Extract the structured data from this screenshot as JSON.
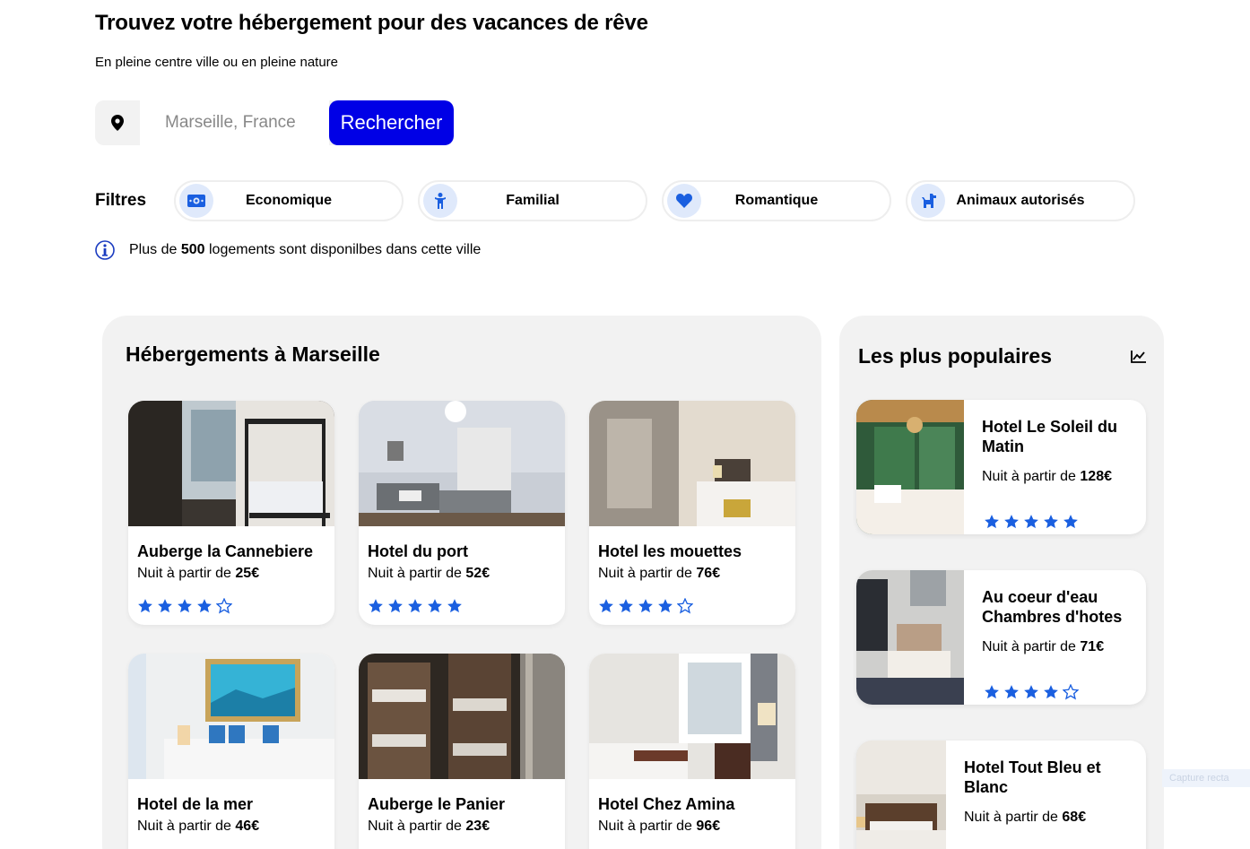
{
  "header": {
    "title": "Trouvez votre hébergement pour des vacances de rêve",
    "subtitle": "En pleine centre ville ou en pleine nature"
  },
  "search": {
    "placeholder": "Marseille, France",
    "button_label": "Rechercher",
    "icon": "map-pin-icon"
  },
  "filters": {
    "label": "Filtres",
    "items": [
      {
        "label": "Economique",
        "icon": "money-icon"
      },
      {
        "label": "Familial",
        "icon": "child-icon"
      },
      {
        "label": "Romantique",
        "icon": "heart-icon"
      },
      {
        "label": "Animaux autorisés",
        "icon": "dog-icon"
      }
    ]
  },
  "info": {
    "prefix": "Plus de",
    "count": "500",
    "suffix": "logements sont disponilbes dans cette ville"
  },
  "listings": {
    "title": "Hébergements à Marseille",
    "price_prefix": "Nuit à partir de",
    "items": [
      {
        "name": "Auberge la Cannebiere",
        "price": "25€",
        "rating": 4
      },
      {
        "name": "Hotel du port",
        "price": "52€",
        "rating": 5
      },
      {
        "name": "Hotel les mouettes",
        "price": "76€",
        "rating": 4
      },
      {
        "name": "Hotel de la mer",
        "price": "46€",
        "rating": null
      },
      {
        "name": "Auberge le Panier",
        "price": "23€",
        "rating": null
      },
      {
        "name": "Hotel Chez Amina",
        "price": "96€",
        "rating": null
      }
    ]
  },
  "popular": {
    "title": "Les plus populaires",
    "icon": "trend-chart-icon",
    "price_prefix": "Nuit à partir de",
    "items": [
      {
        "name": "Hotel Le Soleil du Matin",
        "price": "128€",
        "rating": 5
      },
      {
        "name": "Au coeur d'eau Chambres d'hotes",
        "price": "71€",
        "rating": 4
      },
      {
        "name": "Hotel Tout Bleu et Blanc",
        "price": "68€",
        "rating": null
      }
    ]
  },
  "overlay": {
    "label": "Capture recta"
  },
  "colors": {
    "accent": "#0000e6",
    "star": "#1a5fe0",
    "panel": "#f2f2f2",
    "filter_icon_bg": "#dfe9fb"
  }
}
